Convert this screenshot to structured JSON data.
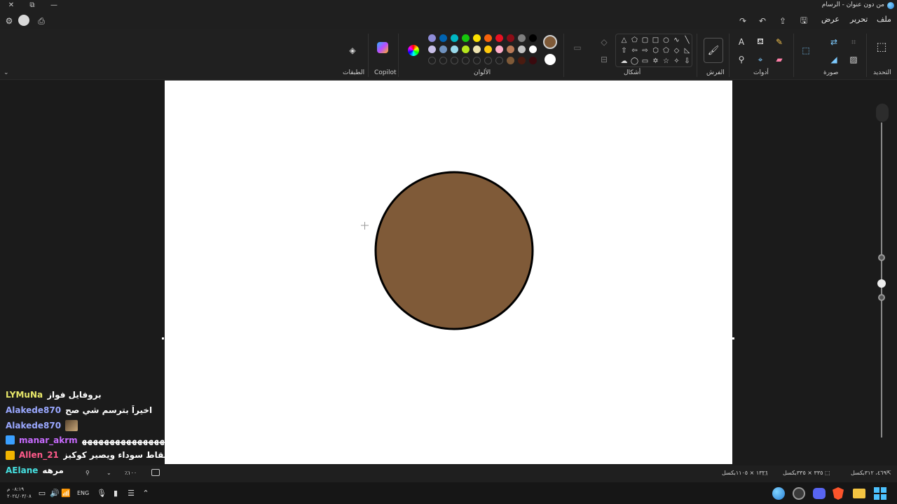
{
  "window": {
    "title": "من دون عنوان - الرسام",
    "controls": {
      "close": "✕",
      "maximize": "⧉",
      "minimize": "—"
    }
  },
  "menu": {
    "file": "ملف",
    "edit": "تحرير",
    "view": "عرض"
  },
  "ribbon": {
    "groups": {
      "select": "التحديد",
      "image": "صورة",
      "tools": "أدوات",
      "brushes": "الفرش",
      "shapes": "أشكال",
      "colors": "الألوان",
      "copilot": "Copilot",
      "layers": "الطبقات"
    },
    "colors": {
      "primary": "#7f5a38",
      "secondary": "#ffffff",
      "row1": [
        "#000000",
        "#7f7f7f",
        "#8b0d17",
        "#e81123",
        "#f7630c",
        "#fce100",
        "#16c60c",
        "#00b7c3",
        "#0063b1",
        "#8e8cd8"
      ],
      "row2": [
        "#ffffff",
        "#c3c3c3",
        "#b97a57",
        "#ffaec9",
        "#ffc90e",
        "#efe4b0",
        "#b5e61d",
        "#99d9ea",
        "#7092be",
        "#c8bfe7"
      ],
      "row3": [
        "#3a0a0e",
        "#4a1b10",
        "#7f5a38",
        "empty",
        "empty",
        "empty",
        "empty",
        "empty",
        "empty",
        "empty"
      ]
    }
  },
  "canvas": {
    "background": "#ffffff",
    "circle_fill": "#7f5a38",
    "circle_stroke": "#000000"
  },
  "status": {
    "cursor_pos": "٤٦٩، ٣١٢بكسل",
    "selection_size": "٣٣٥ × ٣٣٥بكسل",
    "canvas_size": "١٣٢١ × ١١٠٥بكسل",
    "zoom": "٪١٠٠"
  },
  "chat": [
    {
      "user": "LYMuNa",
      "message": "بروفايل فواز",
      "color": "#e8e86a",
      "badge": ""
    },
    {
      "user": "Alakede870",
      "message": "اخيراً بترسم شي صح",
      "color": "#9aa8ff",
      "badge": ""
    },
    {
      "user": "Alakede870",
      "message": "",
      "color": "#9aa8ff",
      "badge": "emote"
    },
    {
      "user": "manar_akrm",
      "message": "ههههههههههههههههههههههههههههههههههههههههههههه",
      "color": "#c86bff",
      "badge": "#3aa0ff"
    },
    {
      "user": "Allen_21",
      "message": "حطي نقاط سوداء ويصير كوكيز",
      "color": "#ff5a8a",
      "badge": "#f0b400"
    },
    {
      "user": "AElane",
      "message": "مرهه",
      "color": "#46e0e0",
      "badge": ""
    }
  ],
  "taskbar": {
    "time": "٠٨:١٩ م",
    "date": "٢٠٢٤/٠٣/٠٨",
    "language": "ENG"
  }
}
